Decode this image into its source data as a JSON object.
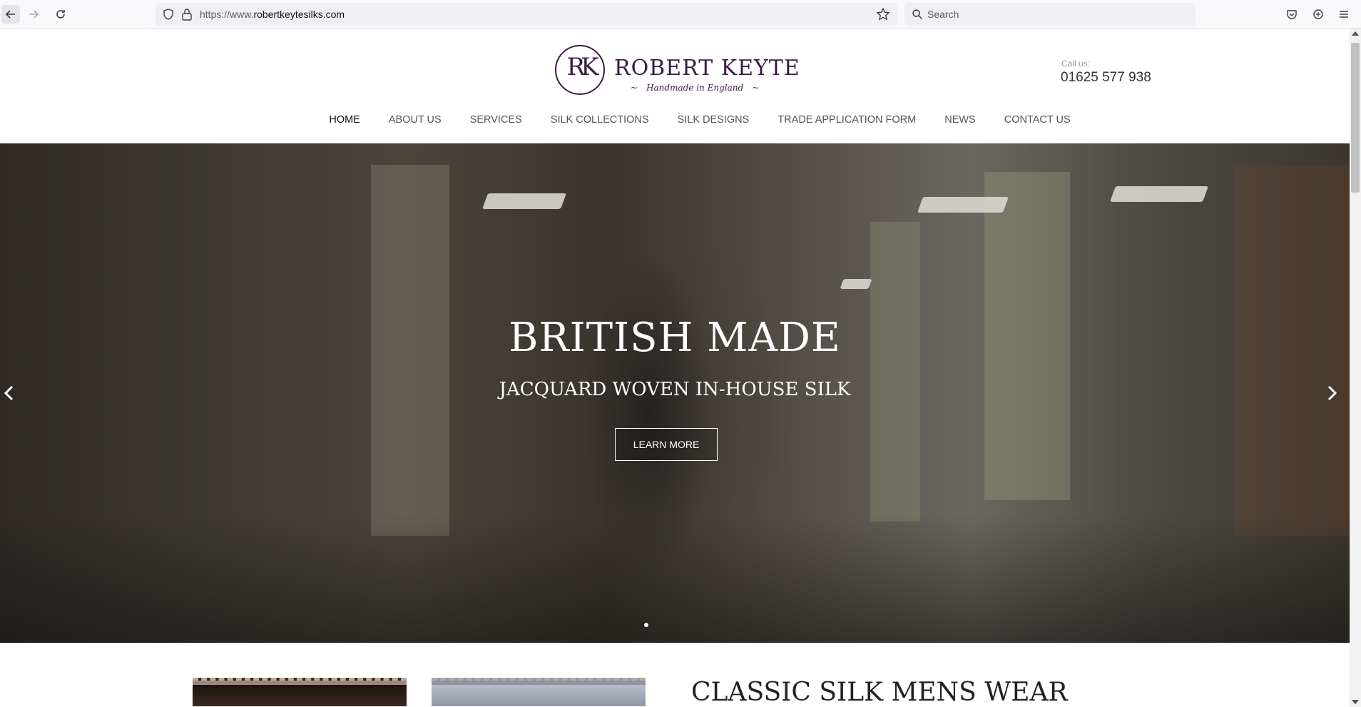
{
  "browser": {
    "url_prefix": "https://www.",
    "url_host": "robertkeytesilks.com",
    "search_placeholder": "Search"
  },
  "header": {
    "logo_monogram": "RK",
    "logo_name": "ROBERT KEYTE",
    "logo_tagline": "Handmade in England",
    "call_label": "Call us:",
    "phone": "01625 577 938"
  },
  "nav": {
    "items": [
      {
        "label": "HOME"
      },
      {
        "label": "ABOUT US"
      },
      {
        "label": "SERVICES"
      },
      {
        "label": "SILK COLLECTIONS"
      },
      {
        "label": "SILK DESIGNS"
      },
      {
        "label": "TRADE APPLICATION FORM"
      },
      {
        "label": "NEWS"
      },
      {
        "label": "CONTACT US"
      }
    ]
  },
  "hero": {
    "title": "BRITISH MADE",
    "subtitle": "JACQUARD WOVEN IN-HOUSE SILK",
    "button": "LEARN MORE"
  },
  "section": {
    "title": "CLASSIC SILK MENS WEAR"
  },
  "colors": {
    "brand": "#3a1c44"
  }
}
